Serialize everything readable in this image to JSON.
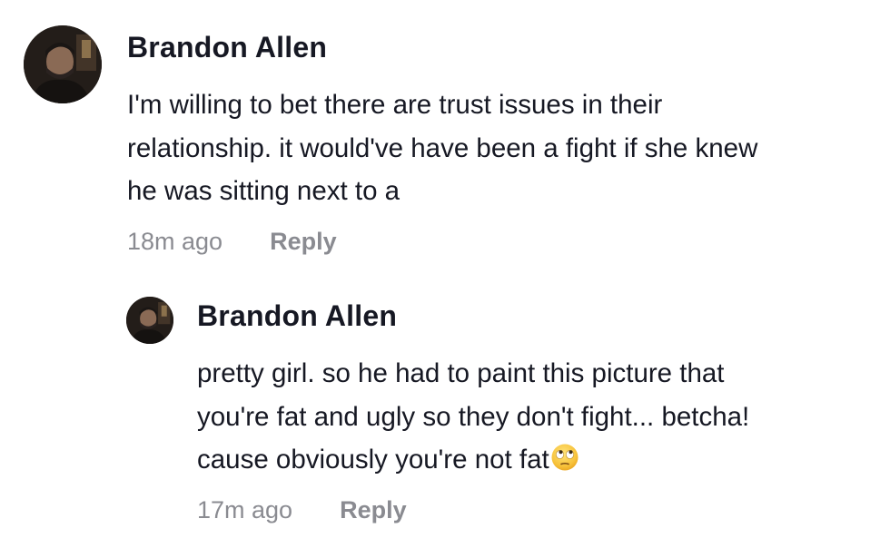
{
  "comments": [
    {
      "author": "Brandon Allen",
      "avatar": "user-avatar",
      "lines": [
        "I'm willing to bet there are trust issues in their",
        "relationship. it would've have been a fight if she knew",
        "he was sitting next to a"
      ],
      "timestamp": "18m ago",
      "reply_label": "Reply"
    },
    {
      "author": "Brandon Allen",
      "avatar": "user-avatar",
      "lines": [
        "pretty girl. so he had to paint this picture that",
        "you're fat and ugly so they don't fight... betcha!",
        "cause obviously you're not fat"
      ],
      "emoji": "face-with-rolling-eyes",
      "timestamp": "17m ago",
      "reply_label": "Reply"
    }
  ],
  "colors": {
    "text": "#161823",
    "muted": "#8a8b91",
    "background": "#ffffff"
  }
}
